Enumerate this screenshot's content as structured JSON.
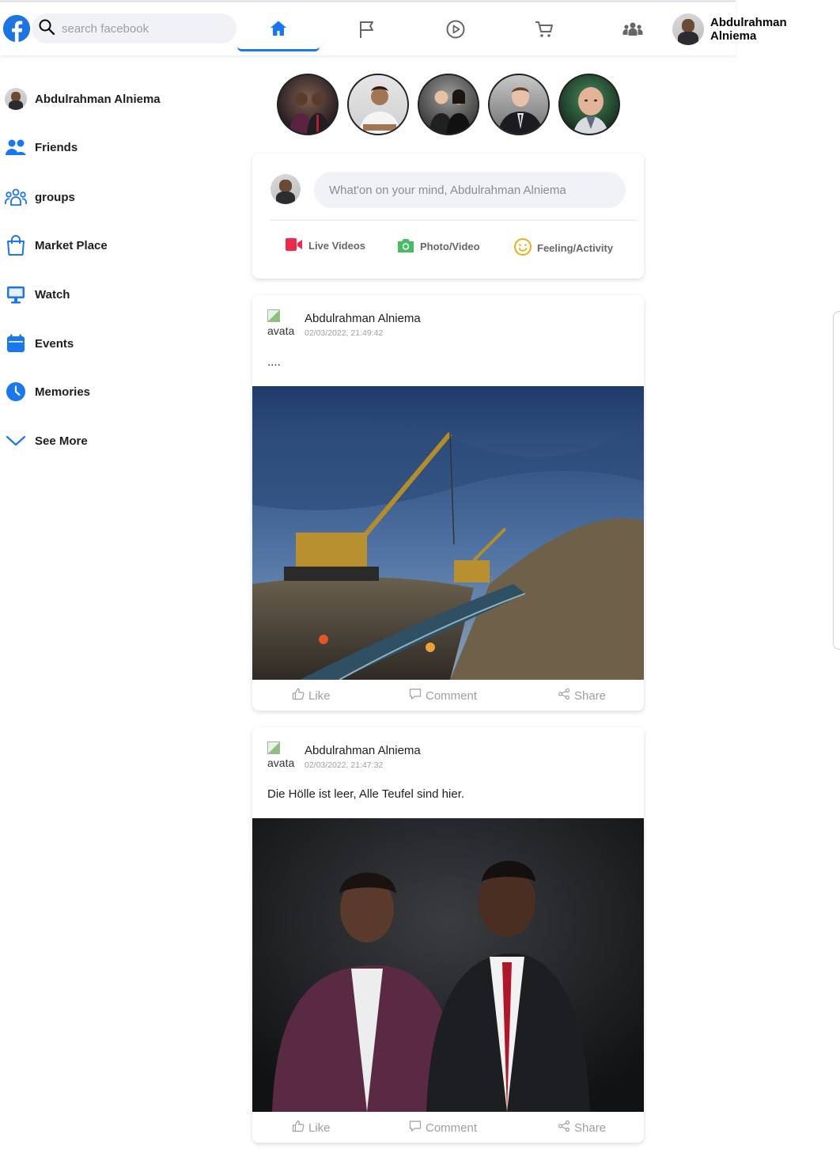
{
  "header": {
    "search_placeholder": "search facebook",
    "user_name": "Abdulrahman Alniema",
    "nav": [
      {
        "icon": "home-icon",
        "active": true
      },
      {
        "icon": "flag-icon",
        "active": false
      },
      {
        "icon": "play-icon",
        "active": false
      },
      {
        "icon": "cart-icon",
        "active": false
      },
      {
        "icon": "people-group-icon",
        "active": false
      }
    ]
  },
  "sidebar": {
    "profile_name": "Abdulrahman Alniema",
    "items": [
      {
        "label": "Friends",
        "icon": "friends-icon"
      },
      {
        "label": "groups",
        "icon": "groups-icon"
      },
      {
        "label": "Market Place",
        "icon": "shopping-bag-icon"
      },
      {
        "label": "Watch",
        "icon": "monitor-icon"
      },
      {
        "label": "Events",
        "icon": "calendar-icon"
      },
      {
        "label": "Memories",
        "icon": "clock-icon"
      },
      {
        "label": "See More",
        "icon": "chevron-down-icon"
      }
    ]
  },
  "composer": {
    "placeholder": "What'on on your mind, Abdulrahman Alniema",
    "actions": [
      {
        "label": "Live Videos",
        "icon": "video-camera-icon",
        "color": "#f02849"
      },
      {
        "label": "Photo/Video",
        "icon": "camera-icon",
        "color": "#45bd62"
      },
      {
        "label": "Feeling/Activity",
        "icon": "smiley-icon",
        "color": "#f7b928"
      }
    ]
  },
  "posts": [
    {
      "avatar_alt": "avata",
      "author": "Abdulrahman Alniema",
      "timestamp": "02/03/2022, 21:49:42",
      "text": "....",
      "image_subject": "construction-pipeline-photo",
      "actions": {
        "like": "Like",
        "comment": "Comment",
        "share": "Share"
      }
    },
    {
      "avatar_alt": "avata",
      "author": "Abdulrahman Alniema",
      "timestamp": "02/03/2022, 21:47:32",
      "text": "Die Hölle ist leer, Alle Teufel sind hier.",
      "image_subject": "two-men-portrait-photo",
      "actions": {
        "like": "Like",
        "comment": "Comment",
        "share": "Share"
      }
    }
  ],
  "colors": {
    "brand": "#1877f2",
    "muted": "#9aa0a6"
  }
}
